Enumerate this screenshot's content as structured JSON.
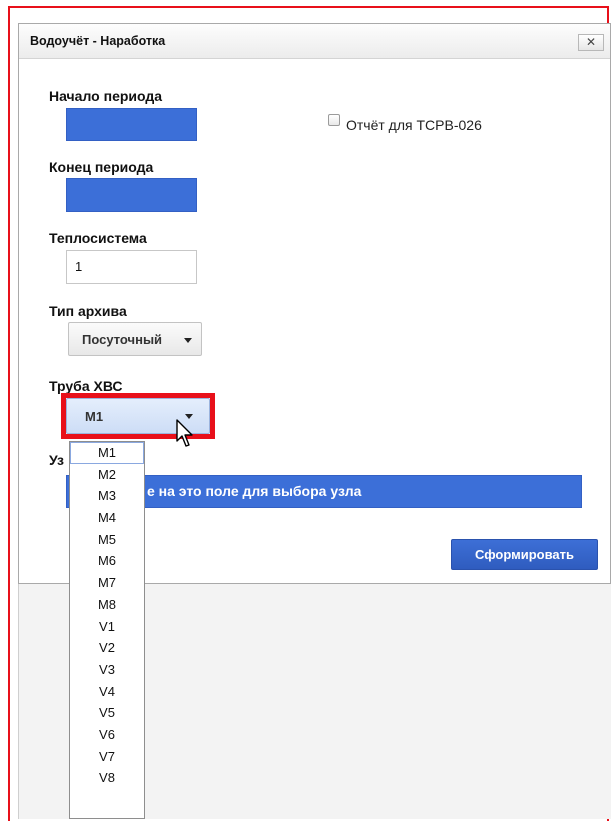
{
  "dialog": {
    "title": "Водоучёт - Наработка",
    "close_label": "✕"
  },
  "form": {
    "start_label": "Начало периода",
    "end_label": "Конец периода",
    "heat_system_label": "Теплосистема",
    "heat_system_value": "1",
    "archive_type_label": "Тип архива",
    "archive_type_value": "Посуточный",
    "report_checkbox_label": "Отчёт для ТСРВ-026",
    "report_checkbox_checked": false,
    "pipe_label": "Труба ХВС",
    "pipe_value": "M1",
    "node_label": "Уз",
    "node_hint": "е на это поле для выбора узла",
    "submit_label": "Сформировать"
  },
  "pipe_options": [
    "M1",
    "M2",
    "M3",
    "M4",
    "M5",
    "M6",
    "M7",
    "M8",
    "V1",
    "V2",
    "V3",
    "V4",
    "V5",
    "V6",
    "V7",
    "V8"
  ],
  "icons": {
    "caret": "chevron-down-icon",
    "cursor": "mouse-pointer-icon",
    "close": "close-icon"
  },
  "colors": {
    "accent_blue": "#3c6fd8",
    "highlight_red": "#e8101a"
  }
}
